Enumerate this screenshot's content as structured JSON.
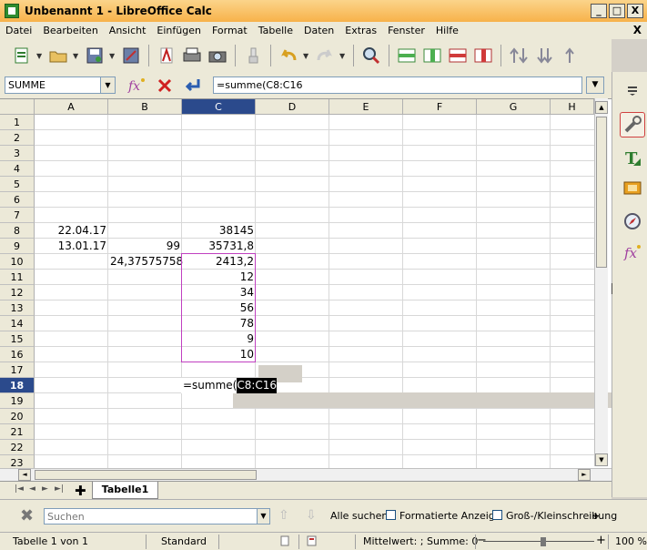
{
  "window": {
    "title": "Unbenannt 1 - LibreOffice Calc",
    "min": "_",
    "max": "□",
    "close": "X"
  },
  "menu": [
    "Datei",
    "Bearbeiten",
    "Ansicht",
    "Einfügen",
    "Format",
    "Tabelle",
    "Daten",
    "Extras",
    "Fenster",
    "Hilfe"
  ],
  "menu_close": "X",
  "formula_bar": {
    "name_box": "SUMME",
    "formula": "=summe(C8:C16"
  },
  "grid": {
    "columns": [
      "A",
      "B",
      "C",
      "D",
      "E",
      "F",
      "G",
      "H"
    ],
    "selected_column": "C",
    "rows": [
      "1",
      "2",
      "3",
      "4",
      "5",
      "6",
      "7",
      "8",
      "9",
      "10",
      "11",
      "12",
      "13",
      "14",
      "15",
      "16",
      "17",
      "18",
      "19",
      "20",
      "21",
      "22",
      "23"
    ],
    "selected_row": "18",
    "cells": {
      "A8": "22.04.17",
      "C8": "38145",
      "A9": "13.01.17",
      "B9": "99",
      "C9": "35731,8",
      "B10": "24,37575758",
      "C10": "2413,2",
      "C11": "12",
      "C12": "34",
      "C13": "56",
      "C14": "78",
      "C15": "9",
      "C16": "10"
    },
    "edit": {
      "prefix": "=summe(",
      "highlight": "C8:C16"
    }
  },
  "sheets": {
    "active": "Tabelle1"
  },
  "find_bar": {
    "placeholder": "Suchen",
    "find_all": "Alle suchen",
    "formatted_display": "Formatierte Anzeige",
    "match_case": "Groß-/Kleinschreibung",
    "more": "+"
  },
  "status": {
    "sheet": "Tabelle 1 von 1",
    "page_style": "Standard",
    "summary": "Mittelwert: ; Summe: 0",
    "zoom_minus": "−",
    "zoom_plus": "+",
    "zoom": "100 %",
    "zoom_level_percent": 100
  },
  "icons": [
    "new-document-icon",
    "open-icon",
    "save-icon",
    "export-icon",
    "pdf-icon",
    "print-icon",
    "print-preview-icon",
    "clone-formatting-icon",
    "undo-icon",
    "redo-icon",
    "find-replace-icon",
    "insert-row-icon",
    "insert-column-icon",
    "delete-row-icon",
    "delete-column-icon",
    "sort-icon",
    "sort-ascending-icon",
    "sort-descending-icon",
    "function-wizard-icon",
    "cancel-icon",
    "accept-icon",
    "properties-icon",
    "styles-icon",
    "gallery-icon",
    "navigator-icon",
    "functions-icon"
  ]
}
